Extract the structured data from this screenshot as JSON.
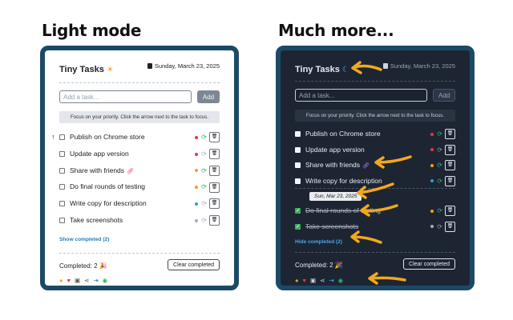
{
  "headings": {
    "left": "Light mode",
    "right": "Much more..."
  },
  "app": {
    "title": "Tiny Tasks",
    "date": "Sunday, March 23, 2025"
  },
  "input": {
    "placeholder": "Add a task...",
    "add_label": "Add"
  },
  "focus_message": "Focus on your priority. Click the arrow next to the task to focus.",
  "light": {
    "tasks": [
      {
        "label": "Publish on Chrome store",
        "dot": "#e5383b",
        "cycle": "#2fb36b",
        "linked": false
      },
      {
        "label": "Update app version",
        "dot": "#e5383b",
        "cycle": "#a9b0bb",
        "linked": false
      },
      {
        "label": "Share with friends",
        "dot": "#f0a01a",
        "cycle": "#2fb36b",
        "linked": true
      },
      {
        "label": "Do final rounds of testing",
        "dot": "#f0a01a",
        "cycle": "#2fb36b",
        "linked": false
      },
      {
        "label": "Write copy for description",
        "dot": "#1fa3d9",
        "cycle": "#a9b0bb",
        "linked": false
      },
      {
        "label": "Take screenshots",
        "dot": "#a3a8c9",
        "cycle": "#a9b0bb",
        "linked": false
      }
    ],
    "show_completed": "Show completed (2)",
    "completed_text": "Completed: 2 🎉",
    "clear_label": "Clear completed"
  },
  "dark": {
    "tasks": [
      {
        "label": "Publish on Chrome store",
        "dot": "#e5383b",
        "cycle": "#2fb36b",
        "linked": false
      },
      {
        "label": "Update app version",
        "dot": "#e5383b",
        "cycle": "#8a93a2",
        "linked": false
      },
      {
        "label": "Share with friends",
        "dot": "#f0a01a",
        "cycle": "#2fb36b",
        "linked": true
      },
      {
        "label": "Write copy for description",
        "dot": "#1fa3d9",
        "cycle": "#2fb36b",
        "linked": false
      }
    ],
    "date_chip": "Sun, Mar 23, 2025",
    "done_tasks": [
      {
        "label": "Do final rounds of testing",
        "dot": "#f0a01a",
        "cycle": "#2fb36b"
      },
      {
        "label": "Take screenshots",
        "dot": "#a3a8c9",
        "cycle": "#8a93a2"
      }
    ],
    "hide_completed": "Hide completed (2)",
    "completed_text": "Completed: 2 🎉",
    "clear_label": "Clear completed"
  },
  "footer_icons": [
    "chat-bubble-icon",
    "heart-icon",
    "folder-icon",
    "share-icon",
    "sign-in-icon",
    "eye-icon"
  ],
  "colors": {
    "frame": "#1c4a66",
    "dark_bg": "#1d2533",
    "accent_arrow": "#f2a81d",
    "link": "#1f7bc4"
  }
}
